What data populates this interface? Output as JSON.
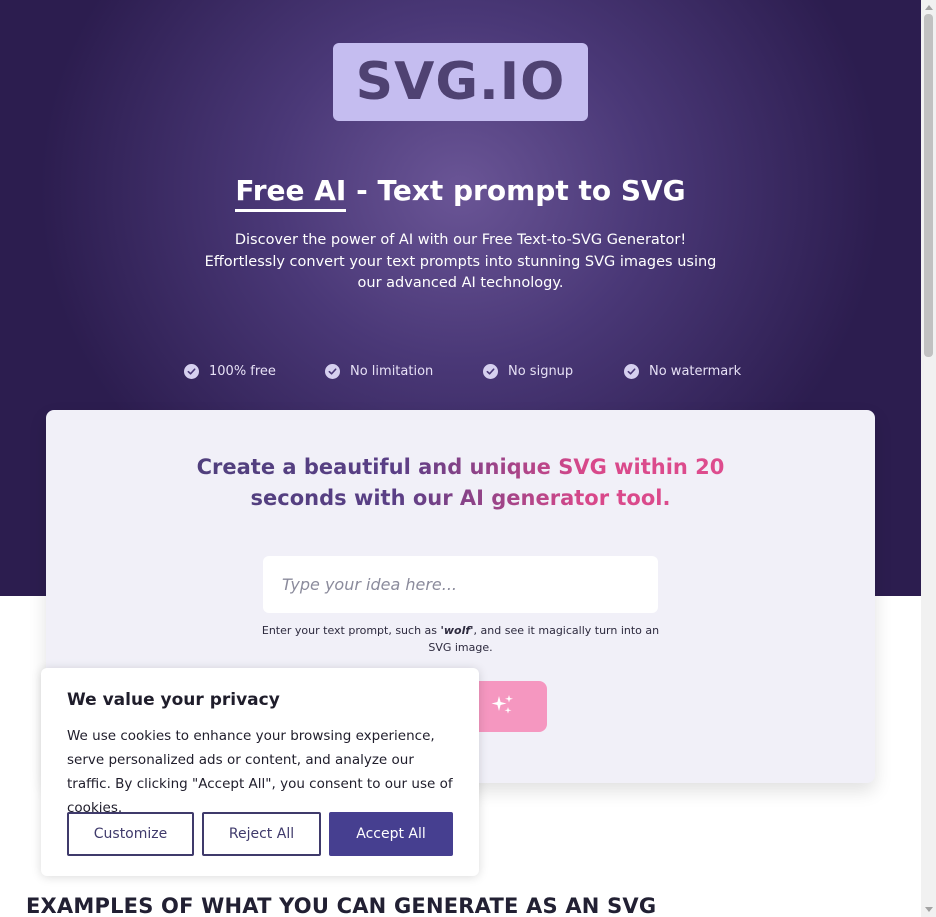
{
  "brand": {
    "logo_text": "SVG.IO"
  },
  "hero": {
    "headline_highlight": "Free AI",
    "headline_rest": " - Text prompt to SVG",
    "subtitle": "Discover the power of AI with our Free Text-to-SVG Generator! Effortlessly convert your text prompts into stunning SVG images using our advanced AI technology.",
    "features": [
      "100% free",
      "No limitation",
      "No signup",
      "No watermark"
    ]
  },
  "generator": {
    "title": "Create a beautiful and unique SVG within 20 seconds with our AI generator tool.",
    "input_placeholder": "Type your idea here...",
    "hint_before": "Enter your text prompt, such as ",
    "hint_example": "'wolf'",
    "hint_after": ", and see it magically turn into an SVG image.",
    "generate_icon": "sparkles-icon"
  },
  "examples": {
    "heading": "EXAMPLES OF WHAT YOU CAN GENERATE AS AN SVG"
  },
  "cookie_banner": {
    "title": "We value your privacy",
    "text": "We use cookies to enhance your browsing experience, serve personalized ads or content, and analyze our traffic. By clicking \"Accept All\", you consent to our use of cookies.",
    "customize_label": "Customize",
    "reject_label": "Reject All",
    "accept_label": "Accept All"
  },
  "colors": {
    "hero_dark": "#2c1d4f",
    "hero_light": "#6a5596",
    "logo_bg": "#c5bdf0",
    "accent_pink": "#f597c0",
    "accept_button": "#463f90"
  }
}
